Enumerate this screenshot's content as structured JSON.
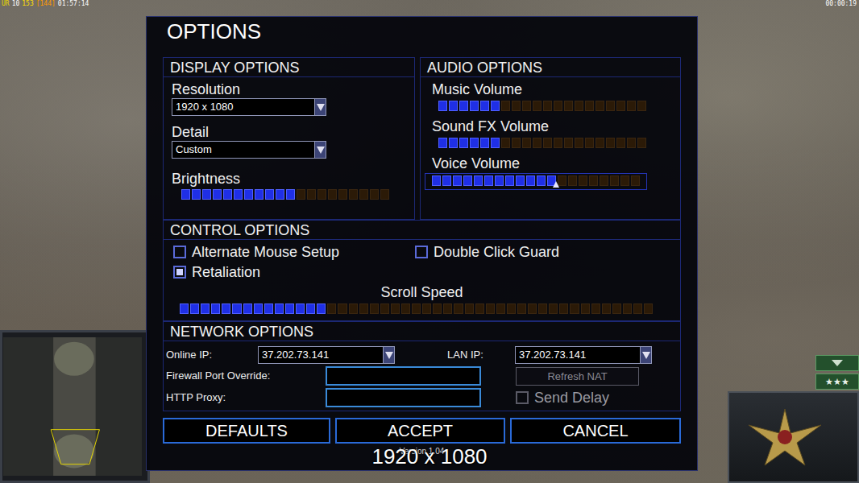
{
  "hud": {
    "stats": [
      {
        "text": "UR",
        "color": "#e8d800"
      },
      {
        "text": "10",
        "color": "#ffffff"
      },
      {
        "text": "153",
        "color": "#ffe000"
      },
      {
        "text": "[144]",
        "color": "#ff9a00"
      },
      {
        "text": "01:57:14",
        "color": "#ffffff"
      }
    ],
    "clock": "00:00:19"
  },
  "dialog": {
    "title": "OPTIONS",
    "display": {
      "title": "DISPLAY OPTIONS",
      "resolution": {
        "label": "Resolution",
        "value": "1920 x 1080"
      },
      "detail": {
        "label": "Detail",
        "value": "Custom"
      },
      "brightness": {
        "label": "Brightness",
        "level": 0.55
      }
    },
    "audio": {
      "title": "AUDIO OPTIONS",
      "sliders": [
        {
          "label": "Music Volume",
          "level": 0.3,
          "focused": false
        },
        {
          "label": "Sound FX Volume",
          "level": 0.3,
          "focused": false
        },
        {
          "label": "Voice Volume",
          "level": 0.6,
          "focused": true
        }
      ]
    },
    "controls": {
      "title": "CONTROL OPTIONS",
      "checkboxes": [
        {
          "label": "Alternate Mouse Setup",
          "checked": false
        },
        {
          "label": "Double Click Guard",
          "checked": false
        },
        {
          "label": "Retaliation",
          "checked": true
        }
      ],
      "scroll_speed": {
        "label": "Scroll Speed",
        "level": 0.31
      }
    },
    "network": {
      "title": "NETWORK OPTIONS",
      "online_ip": {
        "label": "Online IP:",
        "value": "37.202.73.141"
      },
      "lan_ip": {
        "label": "LAN IP:",
        "value": "37.202.73.141"
      },
      "firewall_port": {
        "label": "Firewall Port Override:",
        "value": ""
      },
      "http_proxy": {
        "label": "HTTP Proxy:",
        "value": ""
      },
      "refresh_nat": {
        "label": "Refresh NAT",
        "disabled": true
      },
      "send_delay": {
        "label": "Send Delay",
        "checked": false,
        "disabled": true
      }
    },
    "buttons": [
      {
        "label": "DEFAULTS"
      },
      {
        "label": "ACCEPT"
      },
      {
        "label": "CANCEL"
      }
    ],
    "version": "Version 1.04"
  },
  "overlay": {
    "text": "1920 x 1080"
  },
  "command_bar": {
    "rank": "★★★"
  }
}
